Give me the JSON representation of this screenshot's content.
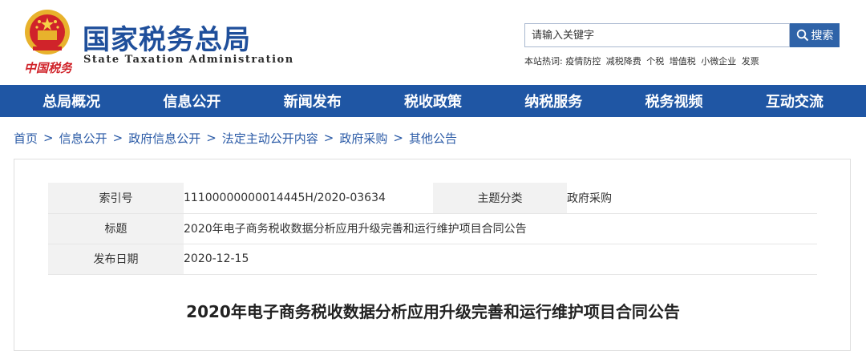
{
  "header": {
    "title": "国家税务总局",
    "subtitle": "State Taxation Administration",
    "slogan": "中国税务"
  },
  "search": {
    "placeholder": "请输入关键字",
    "button_label": "搜索",
    "hot_words_label": "本站热词:",
    "hot_words": [
      "疫情防控",
      "减税降费",
      "个税",
      "增值税",
      "小微企业",
      "发票"
    ]
  },
  "nav": {
    "items": [
      "总局概况",
      "信息公开",
      "新闻发布",
      "税收政策",
      "纳税服务",
      "税务视频",
      "互动交流"
    ]
  },
  "breadcrumb": {
    "items": [
      "首页",
      "信息公开",
      "政府信息公开",
      "法定主动公开内容",
      "政府采购",
      "其他公告"
    ],
    "separator": ">"
  },
  "meta": {
    "index_label": "索引号",
    "index_value": "11100000000014445H/2020-03634",
    "category_label": "主题分类",
    "category_value": "政府采购",
    "title_label": "标题",
    "title_value": "2020年电子商务税收数据分析应用升级完善和运行维护项目合同公告",
    "date_label": "发布日期",
    "date_value": "2020-12-15"
  },
  "article": {
    "title": "2020年电子商务税收数据分析应用升级完善和运行维护项目合同公告"
  },
  "colors": {
    "brand_blue": "#1f4f9b",
    "nav_blue": "#1f56a4",
    "emblem_red": "#d0232a",
    "emblem_gold": "#e8b22c"
  }
}
